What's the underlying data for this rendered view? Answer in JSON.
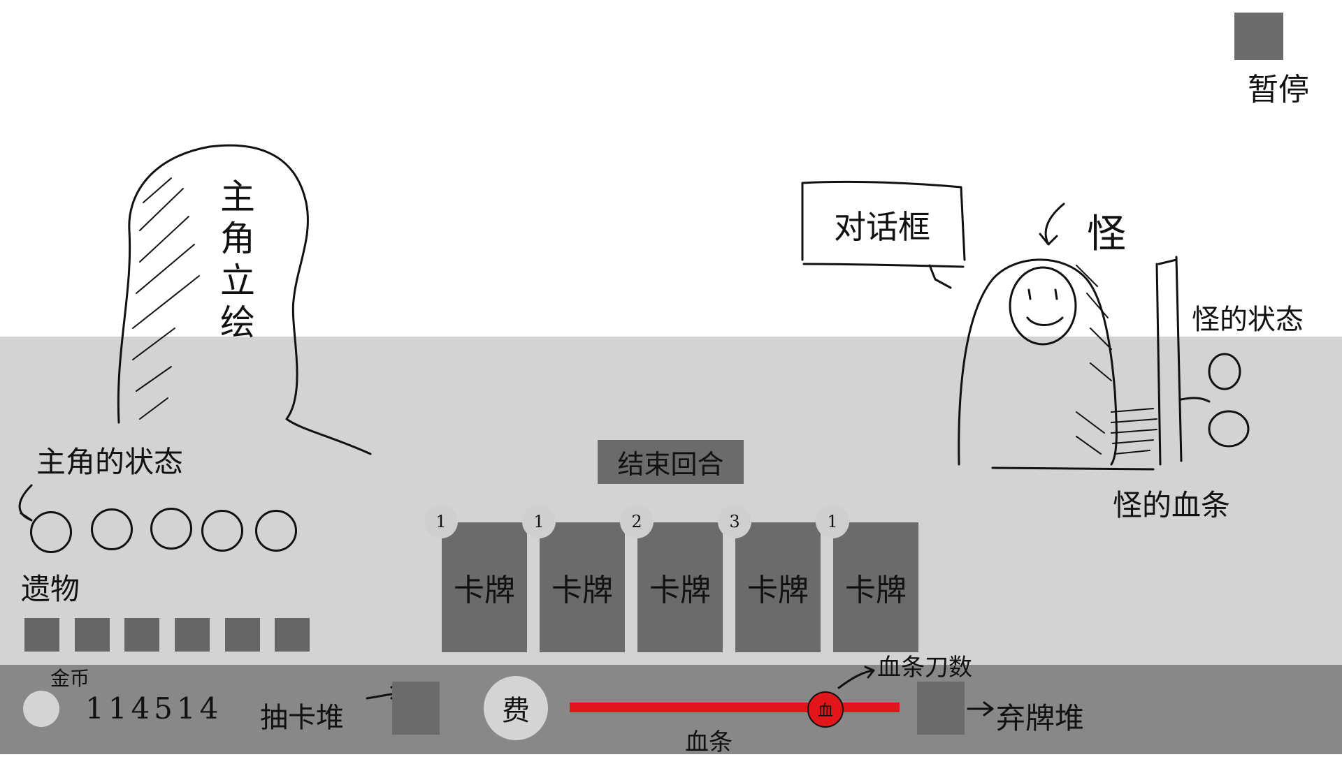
{
  "top_bar": {
    "pause_label": "暂停"
  },
  "hero": {
    "art_label": "主角立绘",
    "status_label": "主角的状态",
    "status_slots": 5
  },
  "relics": {
    "label": "遗物",
    "count": 6
  },
  "monster": {
    "label": "怪",
    "dialog_text": "对话框",
    "status_label": "怪的状态",
    "hp_label": "怪的血条"
  },
  "end_turn": {
    "label": "结束回合"
  },
  "hand": {
    "cards": [
      {
        "cost": "1",
        "label": "卡牌"
      },
      {
        "cost": "1",
        "label": "卡牌"
      },
      {
        "cost": "2",
        "label": "卡牌"
      },
      {
        "cost": "3",
        "label": "卡牌"
      },
      {
        "cost": "1",
        "label": "卡牌"
      }
    ]
  },
  "hud": {
    "gold_label": "金币",
    "gold_value": "114514",
    "draw_pile_label": "抽卡堆",
    "energy_label": "费",
    "hp_bar_label": "血条",
    "hp_count_label": "血条刀数",
    "hp_knob_label": "血",
    "discard_pile_label": "弃牌堆"
  },
  "colors": {
    "stage_bg": "#ffffff",
    "floor_bg": "#d3d3d3",
    "hud_bg": "#888888",
    "block_gray": "#6b6b6b",
    "hp_red": "#e0161a"
  }
}
